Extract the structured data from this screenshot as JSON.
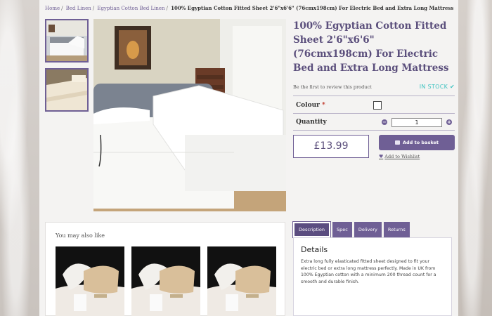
{
  "breadcrumb": {
    "home": "Home",
    "category": "Bed Linen",
    "subcategory": "Egyptian Cotton Bed Linen",
    "current": "100% Egyptian Cotton Fitted Sheet 2'6\"x6'6\" (76cmx198cm) For Electric Bed and Extra Long Mattress"
  },
  "product": {
    "title": "100% Egyptian Cotton Fitted Sheet 2'6\"x6'6\" (76cmx198cm) For Electric Bed and Extra Long Mattress",
    "review_link": "Be the first to review this product",
    "stock_status": "IN STOCK ✔",
    "price": "£13.99"
  },
  "options": {
    "colour_label": "Colour",
    "required_mark": "*",
    "quantity_label": "Quantity",
    "quantity_value": "1",
    "minus": "−",
    "plus": "+"
  },
  "actions": {
    "add_to_basket": "Add to basket",
    "add_to_wishlist": "Add to Wishlist",
    "heart": "♥"
  },
  "related": {
    "title": "You may also like"
  },
  "tabs": [
    {
      "label": "Description"
    },
    {
      "label": "Spec"
    },
    {
      "label": "Delivery"
    },
    {
      "label": "Returns"
    }
  ],
  "details": {
    "heading": "Details",
    "text": "Extra long fully elasticated fitted sheet designed to fit your electric bed or extra long mattress perfectly. Made in UK from 100% Egyptian cotton with a minimum 200 thread count for a smooth and durable finish."
  },
  "colors": {
    "brand": "#6f5f95",
    "stock": "#3ec3c1"
  }
}
